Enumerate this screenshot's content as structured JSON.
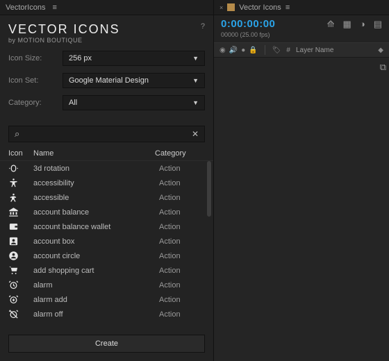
{
  "leftTab": {
    "title": "VectorIcons",
    "menuGlyph": "≡"
  },
  "brand": {
    "title": "VECTOR ICONS",
    "subtitle": "by MOTION BOUTIQUE",
    "help": "?"
  },
  "controls": {
    "iconSize": {
      "label": "Icon Size:",
      "value": "256 px"
    },
    "iconSet": {
      "label": "Icon Set:",
      "value": "Google Material Design"
    },
    "category": {
      "label": "Category:",
      "value": "All"
    }
  },
  "search": {
    "placeholder": ""
  },
  "columns": {
    "icon": "Icon",
    "name": "Name",
    "category": "Category"
  },
  "items": [
    {
      "name": "3d rotation",
      "cat": "Action",
      "icon": "rot3d"
    },
    {
      "name": "accessibility",
      "cat": "Action",
      "icon": "accessibility"
    },
    {
      "name": "accessible",
      "cat": "Action",
      "icon": "accessible"
    },
    {
      "name": "account balance",
      "cat": "Action",
      "icon": "bank"
    },
    {
      "name": "account balance wallet",
      "cat": "Action",
      "icon": "wallet"
    },
    {
      "name": "account box",
      "cat": "Action",
      "icon": "accbox"
    },
    {
      "name": "account circle",
      "cat": "Action",
      "icon": "acccircle"
    },
    {
      "name": "add shopping cart",
      "cat": "Action",
      "icon": "cart"
    },
    {
      "name": "alarm",
      "cat": "Action",
      "icon": "alarm"
    },
    {
      "name": "alarm add",
      "cat": "Action",
      "icon": "alarmadd"
    },
    {
      "name": "alarm off",
      "cat": "Action",
      "icon": "alarmoff"
    }
  ],
  "createLabel": "Create",
  "rightTab": {
    "title": "Vector Icons",
    "menuGlyph": "≡",
    "close": "×"
  },
  "timeline": {
    "timecode": "0:00:00:00",
    "sub": "00000 (25.00 fps)",
    "layerNameLabel": "Layer Name",
    "hash": "#"
  }
}
